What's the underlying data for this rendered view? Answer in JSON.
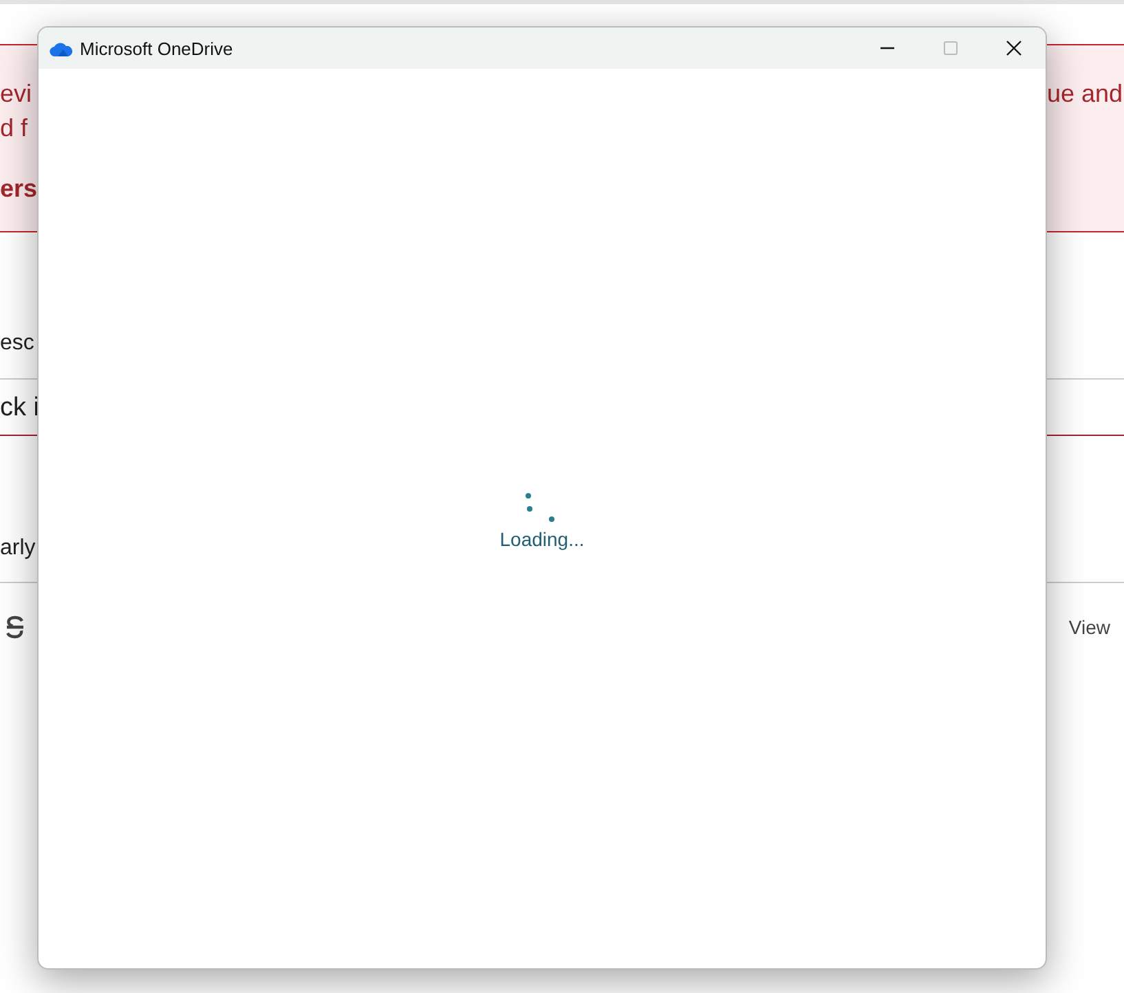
{
  "background_page": {
    "alert": {
      "lines": [
        {
          "left": "evi",
          "right": "ue and",
          "bold": false
        },
        {
          "left": "d f",
          "bold": false
        },
        {
          "left": "ers",
          "bold": true
        }
      ]
    },
    "label_fragment": "esc",
    "field_value": "ck i",
    "text_fragment": "arly",
    "toolbar": {
      "link": "View"
    }
  },
  "window": {
    "title": "Microsoft OneDrive",
    "controls": [
      {
        "kind": "minimize",
        "disabled": false
      },
      {
        "kind": "maximize",
        "disabled": true
      },
      {
        "kind": "close",
        "disabled": false
      }
    ],
    "status": "Loading..."
  }
}
